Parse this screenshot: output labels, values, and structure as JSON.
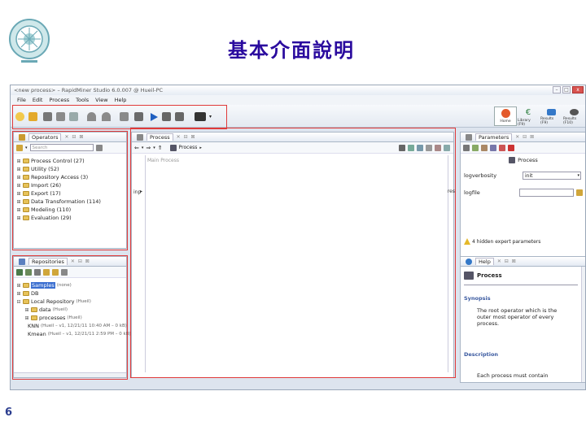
{
  "slide": {
    "title": "基本介面說明",
    "number": "6"
  },
  "window": {
    "title": "<new process> – RapidMiner Studio 6.0.007 @ Hueil-PC",
    "controls": [
      "–",
      "□",
      "x"
    ]
  },
  "menu": [
    "File",
    "Edit",
    "Process",
    "Tools",
    "View",
    "Help"
  ],
  "perspectives": [
    {
      "label": "Home",
      "icon": "home-icon",
      "color": "#e35a2b"
    },
    {
      "label": "Library (F9)",
      "icon": "euro-icon",
      "color": "#2d7f3f"
    },
    {
      "label": "Results (F9)",
      "icon": "tools-icon",
      "color": "#3478c8"
    },
    {
      "label": "Results (F10)",
      "icon": "wrench-icon",
      "color": "#555555"
    }
  ],
  "operators_panel": {
    "tab_label": "Operators",
    "search_placeholder": "Search",
    "items": [
      {
        "label": "Process Control (27)"
      },
      {
        "label": "Utility (52)"
      },
      {
        "label": "Repository Access (3)"
      },
      {
        "label": "Import (26)"
      },
      {
        "label": "Export (17)"
      },
      {
        "label": "Data Transformation (114)"
      },
      {
        "label": "Modeling (110)"
      },
      {
        "label": "Evaluation (29)"
      }
    ]
  },
  "repositories_panel": {
    "tab_label": "Repositories",
    "items": [
      {
        "label": "Samples",
        "meta": "(none)",
        "indent": 0,
        "expander": "⊞",
        "selected": true
      },
      {
        "label": "DB",
        "meta": "",
        "indent": 0,
        "expander": "⊞"
      },
      {
        "label": "Local Repository",
        "meta": "(Hueil)",
        "indent": 0,
        "expander": "⊟"
      },
      {
        "label": "data",
        "meta": "(Hueil)",
        "indent": 1,
        "expander": "⊞"
      },
      {
        "label": "processes",
        "meta": "(Hueil)",
        "indent": 1,
        "expander": "⊞"
      },
      {
        "label": "KNN",
        "meta": "(Hueil – v1, 12/21/11 10:40 AM – 0 kB)",
        "indent": 1,
        "expander": ""
      },
      {
        "label": "Kmean",
        "meta": "(Hueil – v1, 12/21/11 2:59 PM – 0 kB)",
        "indent": 1,
        "expander": ""
      }
    ]
  },
  "process_panel": {
    "tab_label": "Process",
    "breadcrumb": "Process",
    "canvas_title": "Main Process",
    "left_port": "inp",
    "right_port": "res"
  },
  "parameters_panel": {
    "tab_label": "Parameters",
    "operator_name": "Process",
    "params": [
      {
        "name": "logverbosity",
        "value": "init"
      },
      {
        "name": "logfile",
        "value": ""
      }
    ],
    "hidden_note": "4 hidden expert parameters"
  },
  "help_panel": {
    "tab_label": "Help",
    "title": "Process",
    "synopsis_label": "Synopsis",
    "synopsis_text": "The root operator which is the outer most operator of every process.",
    "description_label": "Description",
    "description_text": "Each process must contain"
  },
  "colors": {
    "highlight": "#e03a3a",
    "title": "#2a0a9e",
    "selection": "#3b6fd0"
  }
}
